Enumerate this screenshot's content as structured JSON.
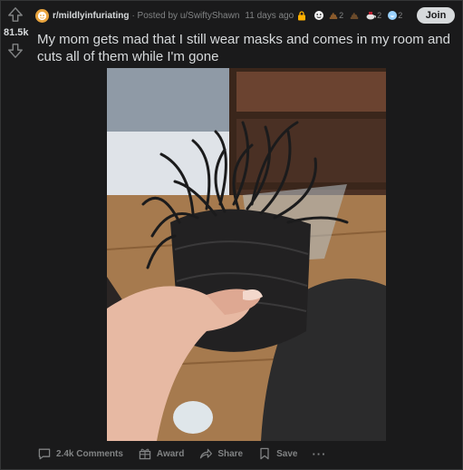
{
  "vote": {
    "score": "81.5k"
  },
  "meta": {
    "subreddit": "r/mildlyinfuriating",
    "posted_by": "· Posted by u/SwiftyShawn",
    "time_ago": "11 days ago",
    "awards": [
      {
        "icon": "lock-award",
        "color": "#ffb000",
        "count": ""
      },
      {
        "icon": "wholesome-award",
        "color": "#f5f5f5",
        "count": ""
      },
      {
        "icon": "poop-award",
        "color": "#8a5a2b",
        "count": "2"
      },
      {
        "icon": "poop-award",
        "color": "#6a4a2a",
        "count": ""
      },
      {
        "icon": "tea-award",
        "color": "#e0e0e0",
        "count": "2"
      },
      {
        "icon": "laugh-award",
        "color": "#9ad2ff",
        "count": "2"
      }
    ]
  },
  "join_label": "Join",
  "title": "My mom gets mad that I still wear masks and comes in my room and cuts all of them while I'm gone",
  "actions": {
    "comments": "2.4k Comments",
    "award": "Award",
    "share": "Share",
    "save": "Save",
    "more": "···"
  },
  "colors": {
    "background": "#1a1a1b",
    "text": "#d7dadc",
    "muted": "#818384",
    "join_bg": "#d7dadc"
  }
}
